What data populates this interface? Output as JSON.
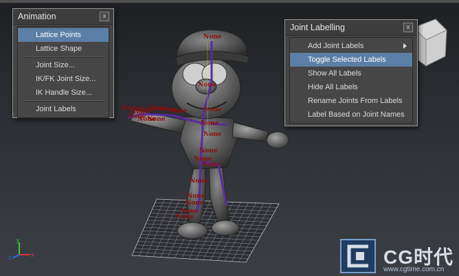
{
  "animation_menu": {
    "title": "Animation",
    "close": "x",
    "items": [
      {
        "label": "Lattice Points",
        "highlighted": true
      },
      {
        "label": "Lattice Shape"
      },
      {
        "separator": true
      },
      {
        "label": "Joint Size..."
      },
      {
        "label": "IK/FK Joint Size..."
      },
      {
        "label": "IK Handle Size..."
      },
      {
        "separator": true
      },
      {
        "label": "Joint Labels"
      }
    ]
  },
  "joint_labelling_menu": {
    "title": "Joint Labelling",
    "close": "x",
    "items": [
      {
        "label": "Add Joint Labels",
        "submenu": true
      },
      {
        "label": "Toggle Selected Labels",
        "highlighted": true
      },
      {
        "label": "Show All Labels"
      },
      {
        "label": "Hide All Labels"
      },
      {
        "label": "Rename Joints From Labels"
      },
      {
        "label": "Label Based on Joint Names"
      }
    ]
  },
  "joint_label_text": "None",
  "axis": {
    "y": "y",
    "x": "x",
    "z": "z"
  },
  "watermark": {
    "brand": "CG时代",
    "url": "www.cgtime.com.cn"
  },
  "colors": {
    "highlight": "#5b7fa6",
    "joint_label": "#8b0d0d",
    "skeleton": "#5a2aa0",
    "axis_x": "#d33",
    "axis_y": "#3c3",
    "axis_z": "#36f"
  }
}
